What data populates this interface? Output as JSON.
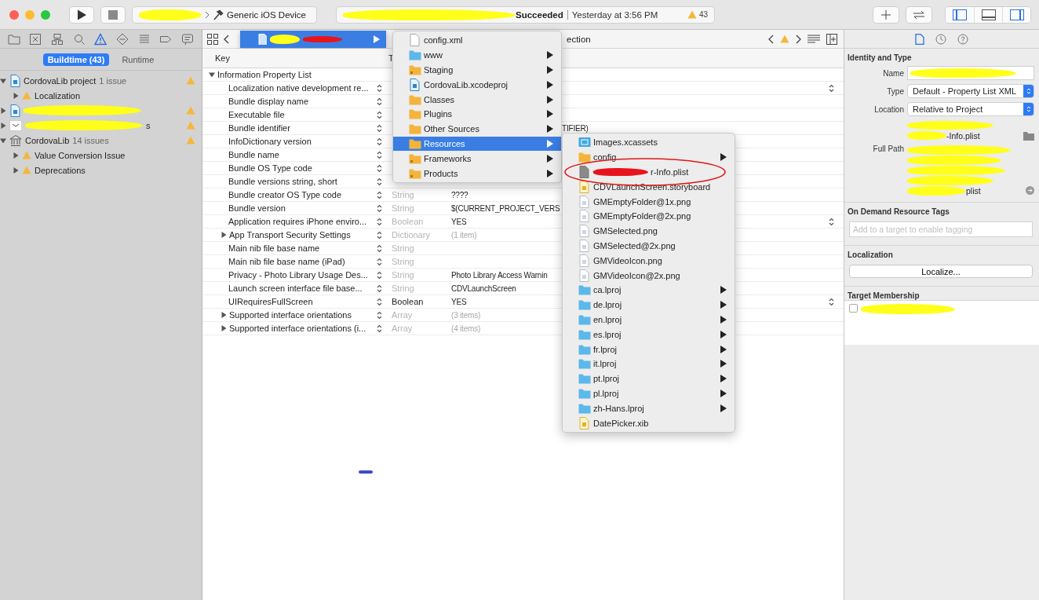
{
  "toolbar": {
    "scheme": {
      "redacted": true,
      "destination": "Generic iOS Device"
    },
    "activity": {
      "redacted": true,
      "status": "Succeeded",
      "time": "Yesterday at 3:56 PM",
      "warnings": "43"
    },
    "panel_toggles": [
      {
        "selected": true
      },
      {
        "selected": false
      },
      {
        "selected": true
      }
    ]
  },
  "navigator": {
    "tabs": [
      {
        "selected": false
      },
      {
        "selected": false
      },
      {
        "selected": false
      },
      {
        "selected": false
      },
      {
        "selected": true
      },
      {
        "selected": false
      },
      {
        "selected": false
      },
      {
        "selected": false
      },
      {
        "selected": false
      }
    ],
    "filters": [
      {
        "label": "Buildtime (43)",
        "selected": true
      },
      {
        "label": "Runtime",
        "selected": false
      }
    ],
    "issues": [
      {
        "kind": "project",
        "name": "CordovaLib project",
        "count": "1 issue",
        "expanded": true,
        "children": [
          {
            "name": "Localization",
            "expanded": false
          }
        ]
      },
      {
        "kind": "project",
        "redacted": true,
        "expanded": false
      },
      {
        "kind": "app",
        "redacted": true,
        "tail": "s",
        "expanded": false
      },
      {
        "kind": "library",
        "name": "CordovaLib",
        "count": "14 issues",
        "expanded": true,
        "children": [
          {
            "name": "Value Conversion Issue",
            "expanded": false
          },
          {
            "name": "Deprecations",
            "expanded": false
          }
        ]
      }
    ]
  },
  "editor": {
    "jump_bar": {
      "crumb": {
        "redacted": true,
        "selected": true
      },
      "tail": "ection"
    },
    "columns": [
      "Key",
      "T"
    ],
    "table": {
      "root": "Information Property List",
      "expanded": true,
      "rows": [
        {
          "key": "Localization native development re...",
          "kind": "item",
          "popup": true
        },
        {
          "key": "Bundle display name",
          "kind": "item"
        },
        {
          "key": "Executable file",
          "kind": "item"
        },
        {
          "key": "Bundle identifier",
          "kind": "item",
          "value": "TIFIER)",
          "partly_covered": true
        },
        {
          "key": "InfoDictionary version",
          "kind": "item"
        },
        {
          "key": "Bundle name",
          "kind": "item"
        },
        {
          "key": "Bundle OS Type code",
          "kind": "item"
        },
        {
          "key": "Bundle versions string, short",
          "kind": "item"
        },
        {
          "key": "Bundle creator OS Type code",
          "kind": "item",
          "type": "String",
          "type_dimmed": true,
          "value": "????"
        },
        {
          "key": "Bundle version",
          "kind": "item",
          "type": "String",
          "type_dimmed": true,
          "value": "$(CURRENT_PROJECT_VERS"
        },
        {
          "key": "Application requires iPhone enviro...",
          "kind": "item",
          "type": "Boolean",
          "type_dimmed": true,
          "value": "YES",
          "popup": true
        },
        {
          "key": "App Transport Security Settings",
          "kind": "collection",
          "type": "Dictionary",
          "type_dimmed": true,
          "value": "(1 item)",
          "expanded": false
        },
        {
          "key": "Main nib file base name",
          "kind": "item",
          "type": "String",
          "type_dimmed": true
        },
        {
          "key": "Main nib file base name (iPad)",
          "kind": "item",
          "type": "String",
          "type_dimmed": true
        },
        {
          "key": "Privacy - Photo Library Usage Des...",
          "kind": "item",
          "type": "String",
          "type_dimmed": true,
          "value": "Photo Library Access Warnin"
        },
        {
          "key": "Launch screen interface file base...",
          "kind": "item",
          "type": "String",
          "type_dimmed": true,
          "value": "CDVLaunchScreen"
        },
        {
          "key": "UIRequiresFullScreen",
          "kind": "item",
          "type": "Boolean",
          "type_dimmed": false,
          "value": "YES",
          "popup": true
        },
        {
          "key": "Supported interface orientations",
          "kind": "collection",
          "type": "Array",
          "type_dimmed": true,
          "value": "(3 items)",
          "expanded": false
        },
        {
          "key": "Supported interface orientations (i...",
          "kind": "collection",
          "type": "Array",
          "type_dimmed": true,
          "value": "(4 items)",
          "expanded": false
        }
      ]
    },
    "menu": {
      "items": [
        {
          "label": "config.xml",
          "kind": "file",
          "submenu": false,
          "selected": false
        },
        {
          "label": "www",
          "kind": "folder-blue",
          "submenu": true,
          "selected": false
        },
        {
          "label": "Staging",
          "kind": "folder-group",
          "submenu": true,
          "selected": false
        },
        {
          "label": "CordovaLib.xcodeproj",
          "kind": "project",
          "submenu": true,
          "selected": false
        },
        {
          "label": "Classes",
          "kind": "folder",
          "submenu": true,
          "selected": false
        },
        {
          "label": "Plugins",
          "kind": "folder",
          "submenu": true,
          "selected": false
        },
        {
          "label": "Other Sources",
          "kind": "folder",
          "submenu": true,
          "selected": false
        },
        {
          "label": "Resources",
          "kind": "folder",
          "submenu": true,
          "selected": true
        },
        {
          "label": "Frameworks",
          "kind": "folder-group",
          "submenu": true,
          "selected": false
        },
        {
          "label": "Products",
          "kind": "folder-group",
          "submenu": true,
          "selected": false
        }
      ]
    },
    "submenu": {
      "items": [
        {
          "label": "Images.xcassets",
          "kind": "assets",
          "submenu": false
        },
        {
          "label": "config",
          "kind": "folder",
          "submenu": true
        },
        {
          "label": "r-Info.plist",
          "kind": "plist",
          "submenu": false,
          "redacted": true,
          "circled": true
        },
        {
          "label": "CDVLaunchScreen.storyboard",
          "kind": "storyboard",
          "submenu": false
        },
        {
          "label": "GMEmptyFolder@1x.png",
          "kind": "image",
          "submenu": false
        },
        {
          "label": "GMEmptyFolder@2x.png",
          "kind": "image",
          "submenu": false
        },
        {
          "label": "GMSelected.png",
          "kind": "image",
          "submenu": false
        },
        {
          "label": "GMSelected@2x.png",
          "kind": "image",
          "submenu": false
        },
        {
          "label": "GMVideoIcon.png",
          "kind": "image",
          "submenu": false
        },
        {
          "label": "GMVideoIcon@2x.png",
          "kind": "image",
          "submenu": false
        },
        {
          "label": "ca.lproj",
          "kind": "folder-blue",
          "submenu": true
        },
        {
          "label": "de.lproj",
          "kind": "folder-blue",
          "submenu": true
        },
        {
          "label": "en.lproj",
          "kind": "folder-blue",
          "submenu": true
        },
        {
          "label": "es.lproj",
          "kind": "folder-blue",
          "submenu": true
        },
        {
          "label": "fr.lproj",
          "kind": "folder-blue",
          "submenu": true
        },
        {
          "label": "it.lproj",
          "kind": "folder-blue",
          "submenu": true
        },
        {
          "label": "pt.lproj",
          "kind": "folder-blue",
          "submenu": true
        },
        {
          "label": "pl.lproj",
          "kind": "folder-blue",
          "submenu": true
        },
        {
          "label": "zh-Hans.lproj",
          "kind": "folder-blue",
          "submenu": true
        },
        {
          "label": "DatePicker.xib",
          "kind": "xib",
          "submenu": false
        }
      ]
    }
  },
  "inspector": {
    "tabs": [
      {
        "selected": true
      },
      {
        "selected": false
      },
      {
        "selected": false
      }
    ],
    "identity": {
      "title": "Identity and Type",
      "name_label": "Name",
      "name_redacted": true,
      "type_label": "Type",
      "type_value": "Default - Property List XML",
      "location_label": "Location",
      "location_value": "Relative to Project",
      "path_tail": "-Info.plist",
      "full_path_label": "Full Path",
      "full_path_tail": "plist"
    },
    "tags": {
      "title": "On Demand Resource Tags",
      "placeholder": "Add to a target to enable tagging"
    },
    "localization": {
      "title": "Localization",
      "button": "Localize..."
    },
    "membership": {
      "title": "Target Membership",
      "targets": [
        {
          "checked": false,
          "redacted": true
        }
      ]
    }
  }
}
